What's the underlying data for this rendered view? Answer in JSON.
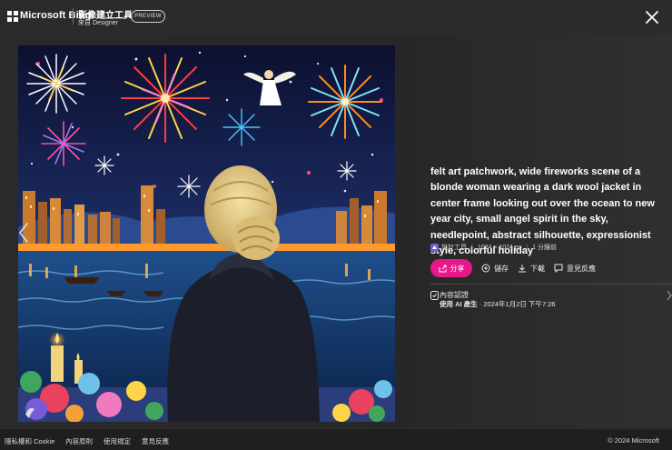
{
  "header": {
    "brand": "Microsoft Bing",
    "tool_title": "影像建立工具",
    "tool_subtitle": "來自 Designer",
    "preview_badge": "PREVIEW"
  },
  "image": {
    "alt": "felt art patchwork, wide fireworks scene of a blonde woman wearing a dark wool jacket in center frame looking out over the ocean to new year city, small angel spirit in the sky, needlepoint, abstract silhouette, expressionist style, colorful holiday"
  },
  "details": {
    "prompt": "felt art patchwork, wide fireworks scene of a blonde woman wearing a dark wool jacket in center frame looking out over the ocean to new year city, small angel spirit in the sky, needlepoint, abstract silhouette, expressionist style, colorful holiday",
    "creator": "設計工具",
    "resolution": "1024 × 1024 px",
    "time_ago": "1 分鐘前",
    "share_label": "分享",
    "save_label": "儲存",
    "download_label": "下載",
    "feedback_label": "意見反應",
    "credentials_title": "內容認證",
    "credentials_prefix": "使用 AI 產生",
    "credentials_date": "· 2024年1月2日 下午7:26"
  },
  "footer": {
    "links": [
      "隱私權和 Cookie",
      "內容原則",
      "使用規定",
      "意見反應"
    ],
    "copyright": "© 2024 Microsoft"
  },
  "colors": {
    "accent": "#e8178a",
    "background": "#2b2b2b",
    "footer": "#1f1f1f"
  }
}
